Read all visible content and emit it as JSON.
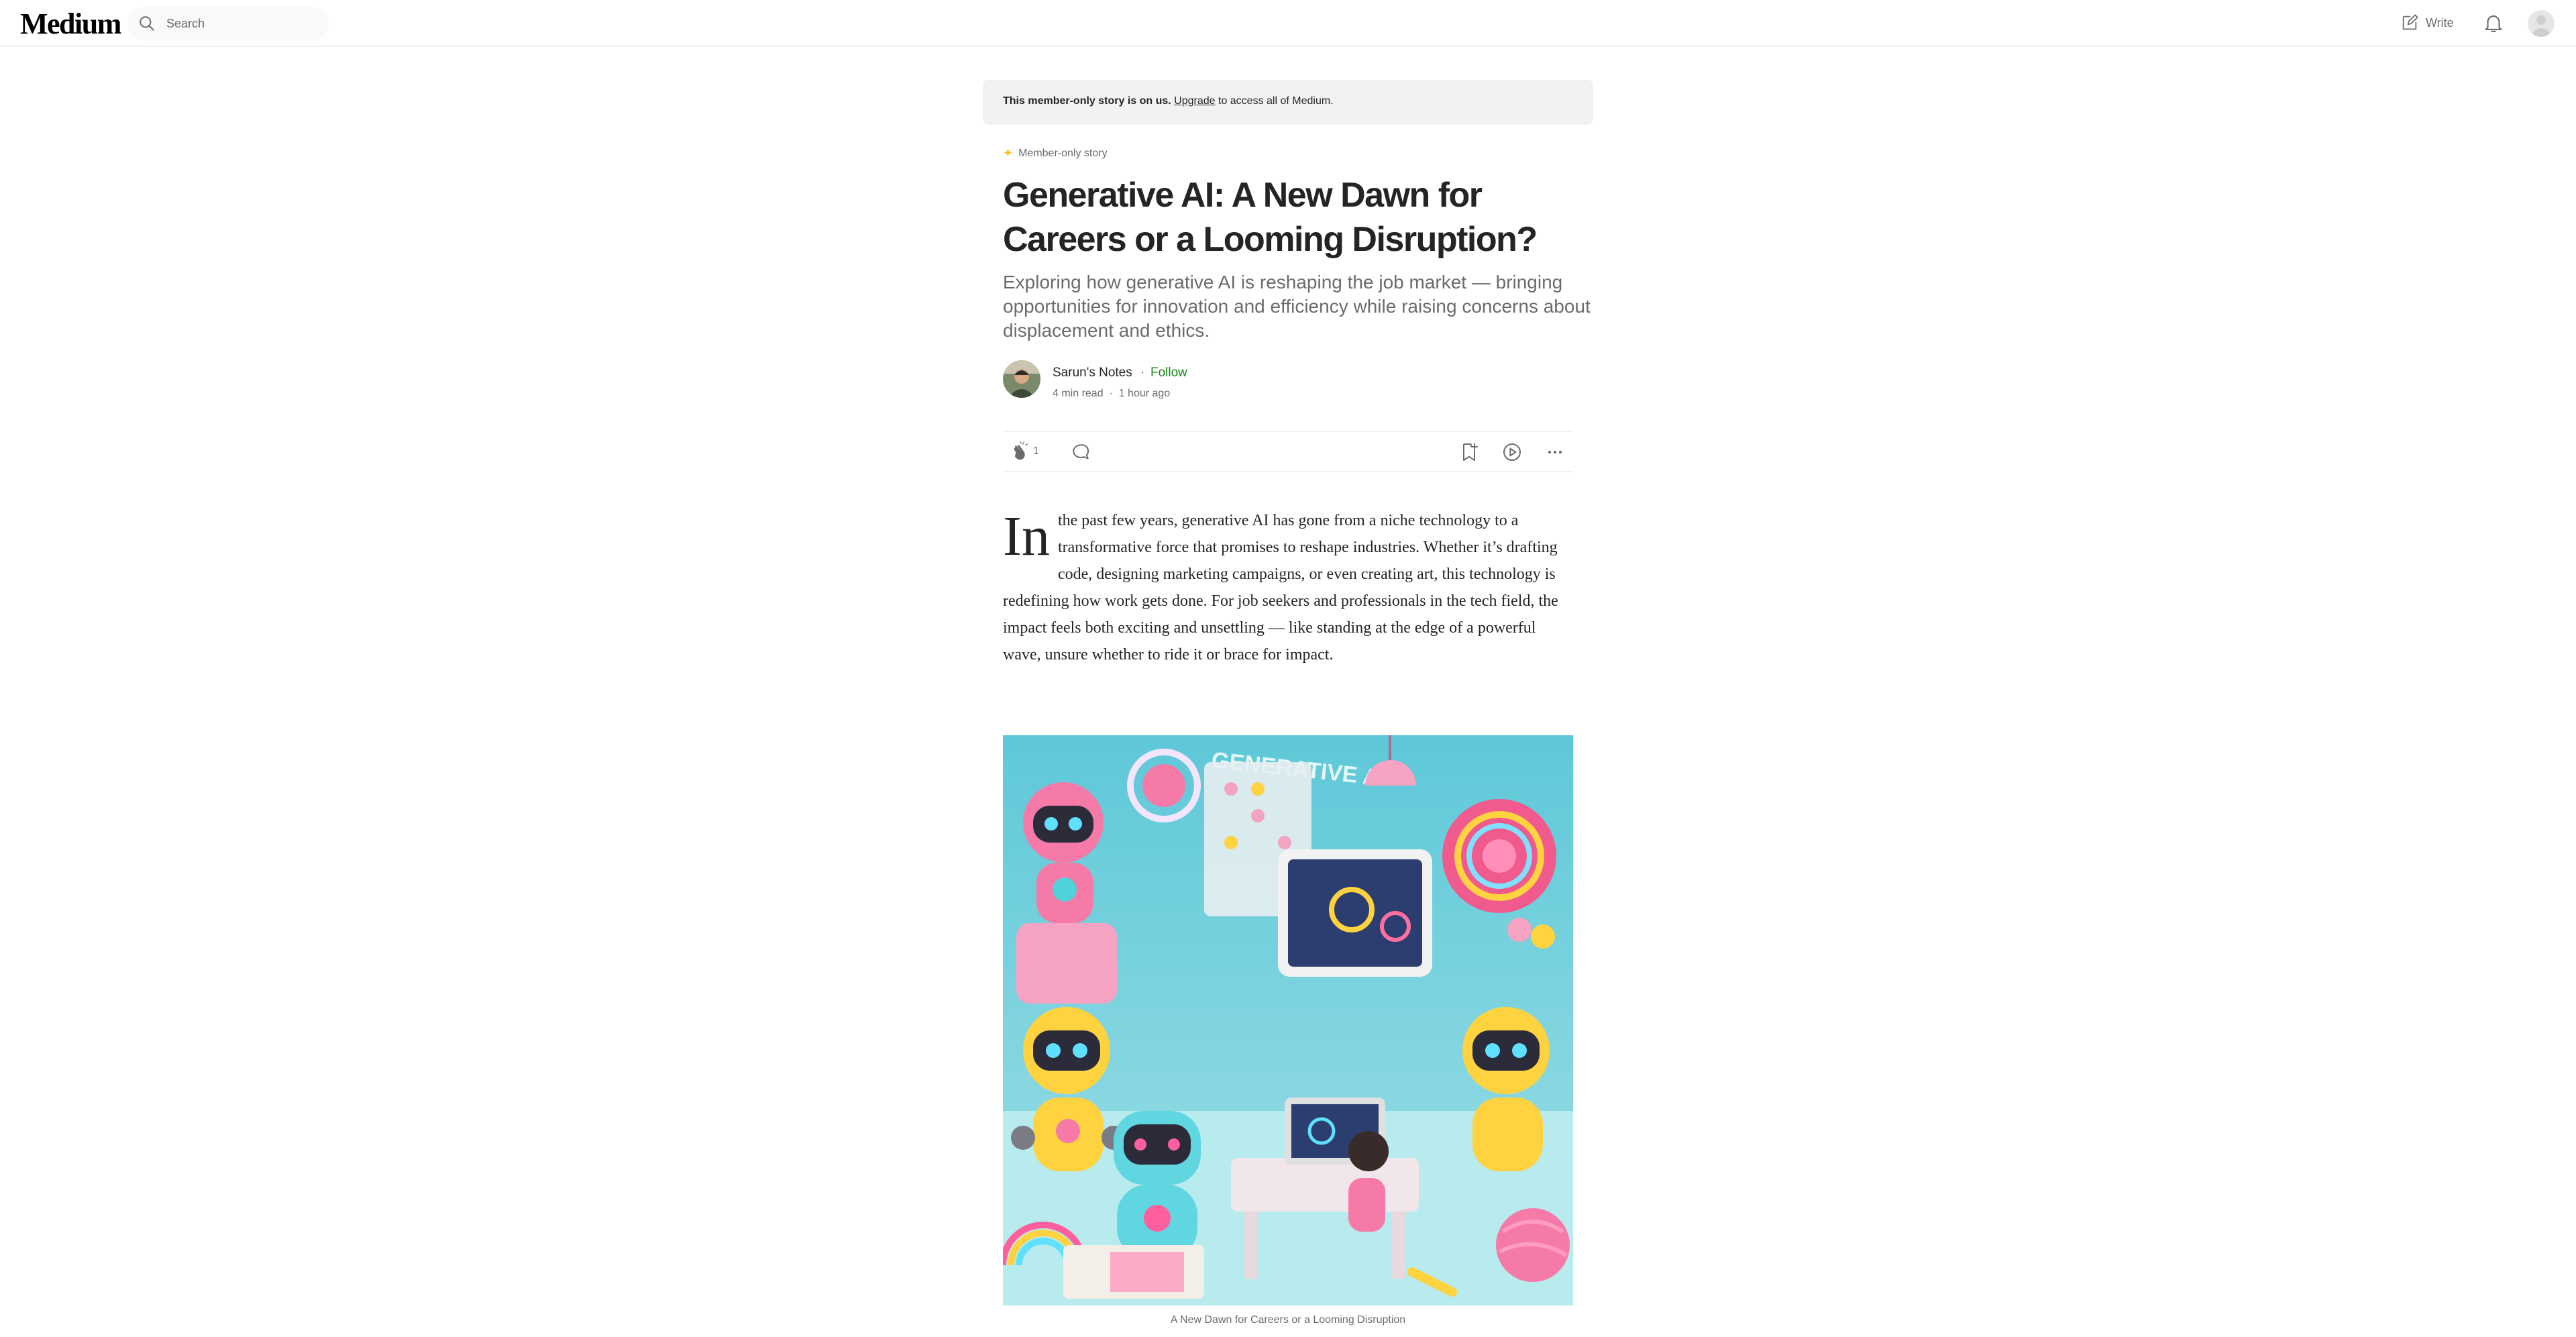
{
  "header": {
    "logo": "Medium",
    "search_placeholder": "Search",
    "write_label": "Write"
  },
  "banner": {
    "bold_text": "This member-only story is on us.",
    "link_text": "Upgrade",
    "rest_text": " to access all of Medium."
  },
  "article": {
    "member_label": "Member-only story",
    "title": "Generative AI: A New Dawn for Careers or a Looming Disruption?",
    "subtitle": "Exploring how generative AI is reshaping the job market — bringing opportunities for innovation and efficiency while raising concerns about displacement and ethics.",
    "author": "Sarun's Notes",
    "follow_label": "Follow",
    "read_time": "4 min read",
    "published": "1 hour ago",
    "clap_count": "1",
    "dropcap": "In",
    "paragraph": " the past few years, generative AI has gone from a niche technology to a transformative force that promises to reshape industries. Whether it’s drafting code, designing marketing campaigns, or even creating art, this technology is redefining how work gets done. For job seekers and professionals in the tech field, the impact feels both exciting and unsettling — like standing at the edge of a powerful wave, unsure whether to ride it or brace for impact.",
    "hero_sign_text": "GENERATIVE AI",
    "caption": "A New Dawn for Careers or a Looming Disruption"
  },
  "colors": {
    "accent_green": "#1a8917",
    "member_star": "#ffc017",
    "text_primary": "#242424",
    "text_secondary": "#6b6b6b"
  }
}
